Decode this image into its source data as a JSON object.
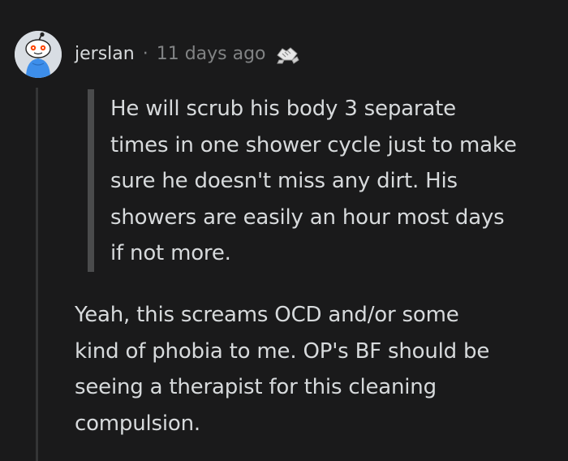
{
  "comment": {
    "username": "jerslan",
    "separator": "·",
    "timestamp": "11 days ago",
    "award_icon": "handshake-award-icon",
    "quote_lines": [
      "He will scrub his body 3 separate",
      "times in one shower cycle just to make",
      "sure he doesn't miss any dirt. His",
      "showers are easily an hour most days",
      "if not more."
    ],
    "body_lines": [
      "Yeah, this screams OCD and/or some",
      "kind of phobia to me. OP's BF should be",
      "seeing a therapist for this cleaning",
      "compulsion."
    ]
  },
  "colors": {
    "background": "#1a1a1b",
    "text": "#d7dadc",
    "meta": "#818384",
    "quote_bar": "#4a4b4c",
    "thread_line": "#343536",
    "avatar_accent": "#ff4500"
  }
}
